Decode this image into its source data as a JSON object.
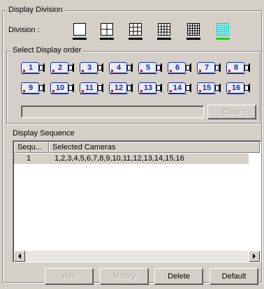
{
  "display_division": {
    "group_title": "Display Division",
    "division_label": "Division :",
    "layouts": [
      {
        "icon": "single-view-icon",
        "selected": false
      },
      {
        "icon": "quad-view-icon",
        "selected": false
      },
      {
        "icon": "nine-view-icon",
        "selected": false
      },
      {
        "icon": "sixteen-view-icon",
        "selected": false
      },
      {
        "icon": "twenty-five-view-icon",
        "selected": false
      },
      {
        "icon": "thirty-six-view-icon",
        "selected": true
      }
    ],
    "selected_color": "#00e000"
  },
  "select_display_order": {
    "group_title": "Select Display order",
    "cameras": [
      "1",
      "2",
      "3",
      "4",
      "5",
      "6",
      "7",
      "8",
      "9",
      "10",
      "11",
      "12",
      "13",
      "14",
      "15",
      "16"
    ],
    "order_field_value": "",
    "clear_label": "Clear"
  },
  "display_sequence": {
    "title": "Display Sequence",
    "columns": [
      "Sequ...",
      "Selected Cameras"
    ],
    "rows": [
      {
        "sequence": "1",
        "cameras": "1,2,3,4,5,6,7,8,9,10,11,12,13,14,15,16"
      }
    ]
  },
  "actions": {
    "add_label": "Add",
    "modify_label": "Modify",
    "delete_label": "Delete",
    "default_label": "Default"
  }
}
